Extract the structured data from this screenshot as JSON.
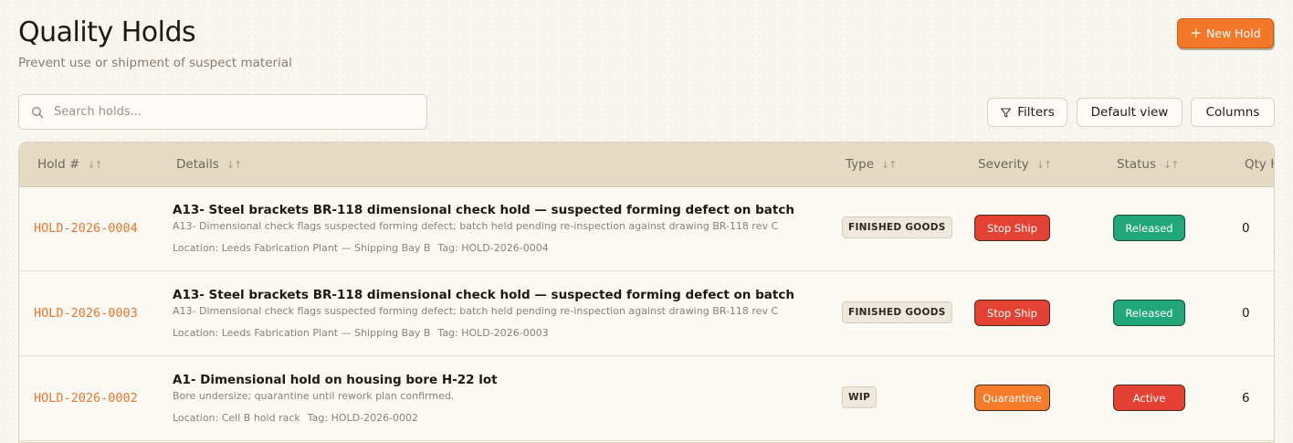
{
  "header": {
    "title": "Quality Holds",
    "subtitle": "Prevent use or shipment of suspect material",
    "new_hold_label": "New Hold"
  },
  "toolbar": {
    "search_placeholder": "Search holds...",
    "filters_label": "Filters",
    "default_view_label": "Default view",
    "columns_label": "Columns"
  },
  "table": {
    "columns": [
      "Hold #",
      "Details",
      "Type",
      "Severity",
      "Status",
      "Qty H"
    ],
    "rows": [
      {
        "id": "HOLD-2026-0004",
        "title": "A13- Steel brackets BR-118 dimensional check hold — suspected forming defect on batch",
        "description": "A13- Dimensional check flags suspected forming defect; batch held pending re-inspection against drawing BR-118 rev C",
        "location": "Location: Leeds Fabrication Plant — Shipping Bay B",
        "tag": "Tag: HOLD-2026-0004",
        "type": "FINISHED GOODS",
        "severity": "Stop Ship",
        "status": "Released",
        "qty": "0"
      },
      {
        "id": "HOLD-2026-0003",
        "title": "A13- Steel brackets BR-118 dimensional check hold — suspected forming defect on batch",
        "description": "A13- Dimensional check flags suspected forming defect; batch held pending re-inspection against drawing BR-118 rev C",
        "location": "Location: Leeds Fabrication Plant — Shipping Bay B",
        "tag": "Tag: HOLD-2026-0003",
        "type": "FINISHED GOODS",
        "severity": "Stop Ship",
        "status": "Released",
        "qty": "0"
      },
      {
        "id": "HOLD-2026-0002",
        "title": "A1- Dimensional hold on housing bore H-22 lot",
        "description": "Bore undersize; quarantine until rework plan confirmed.",
        "location": "Location: Cell B hold rack",
        "tag": "Tag: HOLD-2026-0002",
        "type": "WIP",
        "severity": "Quarantine",
        "status": "Active",
        "qty": "6"
      }
    ]
  },
  "colors": {
    "accent": "#f3782a",
    "severity_stop_ship": "#e34234",
    "severity_quarantine": "#f47b2a",
    "status_released": "#22a77a",
    "status_active": "#e34234",
    "header_bg": "#e5dac4"
  },
  "icons": {
    "new_hold": "plus-icon",
    "search": "search-icon",
    "filters": "filter-icon",
    "sort": "sort-icon"
  }
}
